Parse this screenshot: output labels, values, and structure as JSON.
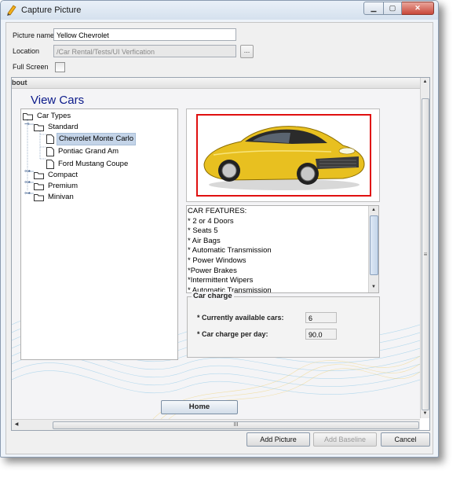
{
  "window": {
    "title": "Capture Picture",
    "minimize_symbol": "▁",
    "maximize_symbol": "▢",
    "close_symbol": "✕"
  },
  "form": {
    "picture_name_label": "Picture name",
    "picture_name_value": "Yellow Chevrolet",
    "location_label": "Location",
    "location_value": "/Car Rental/Tests/UI Verfication",
    "browse_label": "...",
    "full_screen_label": "Full Screen",
    "full_screen_checked": false
  },
  "captured_app": {
    "frame_title": "bout",
    "heading": "View Cars",
    "tree": [
      {
        "label": "Car Types",
        "level": 0,
        "expanded": true
      },
      {
        "label": "Standard",
        "level": 1,
        "expanded": true
      },
      {
        "label": "Chevrolet Monte Carlo",
        "level": 2,
        "selected": true
      },
      {
        "label": "Pontiac Grand Am",
        "level": 2
      },
      {
        "label": "Ford Mustang Coupe",
        "level": 2
      },
      {
        "label": "Compact",
        "level": 1,
        "expanded": false
      },
      {
        "label": "Premium",
        "level": 1,
        "expanded": false
      },
      {
        "label": "Minivan",
        "level": 1,
        "expanded": false
      }
    ],
    "car_image": {
      "color": "#e8c020",
      "highlight": "#e01010"
    },
    "features": [
      "CAR FEATURES:",
      "* 2 or 4 Doors",
      "* Seats 5",
      "* Air Bags",
      "* Automatic Transmission",
      "* Power Windows",
      " *Power Brakes",
      " *Intermittent Wipers",
      "* Automatic Transmission"
    ],
    "car_charge": {
      "title": "Car charge",
      "available_label": "* Currently available cars:",
      "available_value": "6",
      "per_day_label": "* Car charge per day:",
      "per_day_value": "90.0"
    },
    "home_button": "Home",
    "scroll_grip": "III",
    "vscroll_grip": "≡"
  },
  "buttons": {
    "add_picture": "Add Picture",
    "add_baseline": "Add Baseline",
    "cancel": "Cancel"
  },
  "colors": {
    "heading": "#0b1a8a",
    "selection": "#c4d4e8",
    "close_button": "#c9493b"
  }
}
